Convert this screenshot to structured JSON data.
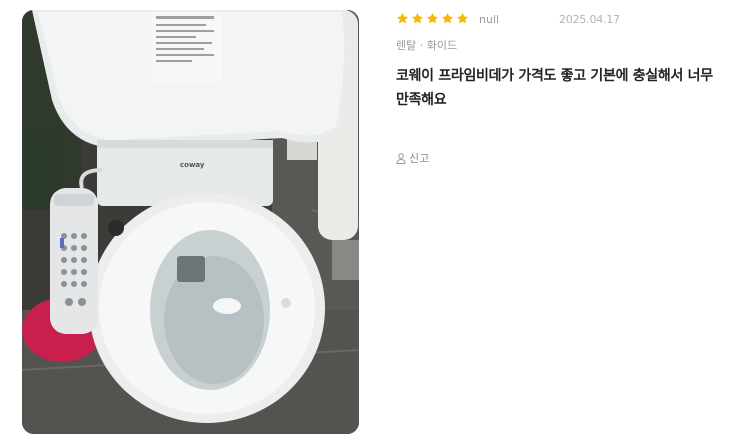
{
  "review": {
    "rating": 5,
    "author": "null",
    "date": "2025.04.17",
    "option": "렌탈 · 화이드",
    "text_line1": "코웨이 프라임비데가 가격도 좋고 기본에 충실해서 너무",
    "text_line2": "만족해요",
    "report_label": "신고",
    "photo_brand": "coway"
  },
  "colors": {
    "star": "#f5b800",
    "text": "#222222",
    "muted": "#9a9a9a"
  },
  "icons": {
    "star": "star-icon",
    "report": "user-report-icon"
  }
}
